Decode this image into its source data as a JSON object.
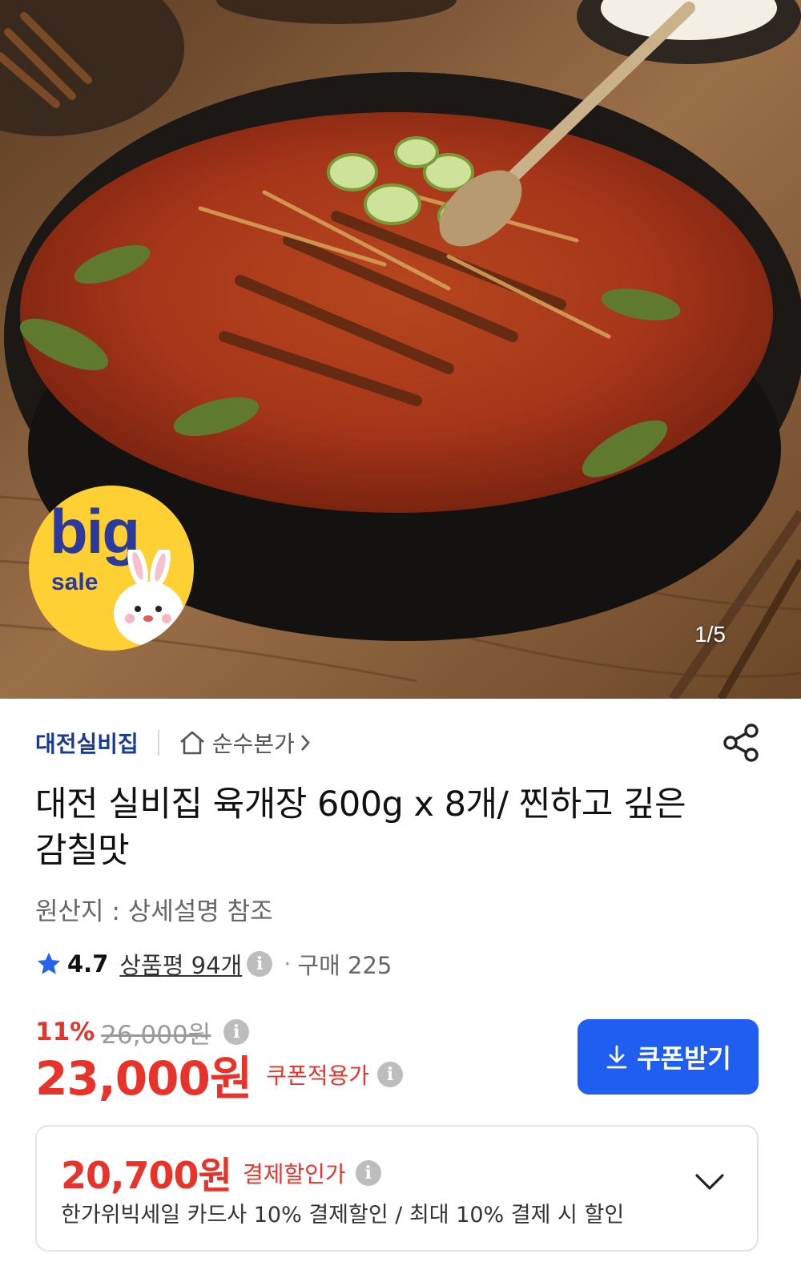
{
  "hero": {
    "counter": "1/5",
    "badge": {
      "big": "big",
      "sale": "sale"
    }
  },
  "seller": {
    "name": "대전실비집",
    "store": "순수본가"
  },
  "product": {
    "title": "대전 실비집 육개장 600g x 8개/ 찐하고 깊은 감칠맛",
    "origin": "원산지 : 상세설명 참조"
  },
  "rating": {
    "score": "4.7",
    "reviews": "상품평 94개",
    "purchase": "구매 225"
  },
  "price": {
    "discount": "11%",
    "original": "26,000원",
    "final": "23,000원",
    "final_label": "쿠폰적용가",
    "coupon_button": "쿠폰받기"
  },
  "payment": {
    "value": "20,700원",
    "label": "결제할인가",
    "description": "한가위빅세일  카드사 10% 결제할인 / 최대 10% 결제 시 할인"
  },
  "colors": {
    "accent_red": "#e8332a",
    "brand_blue": "#1f5ef0",
    "seller_blue": "#1a3a9a",
    "badge_yellow": "#ffd034"
  }
}
